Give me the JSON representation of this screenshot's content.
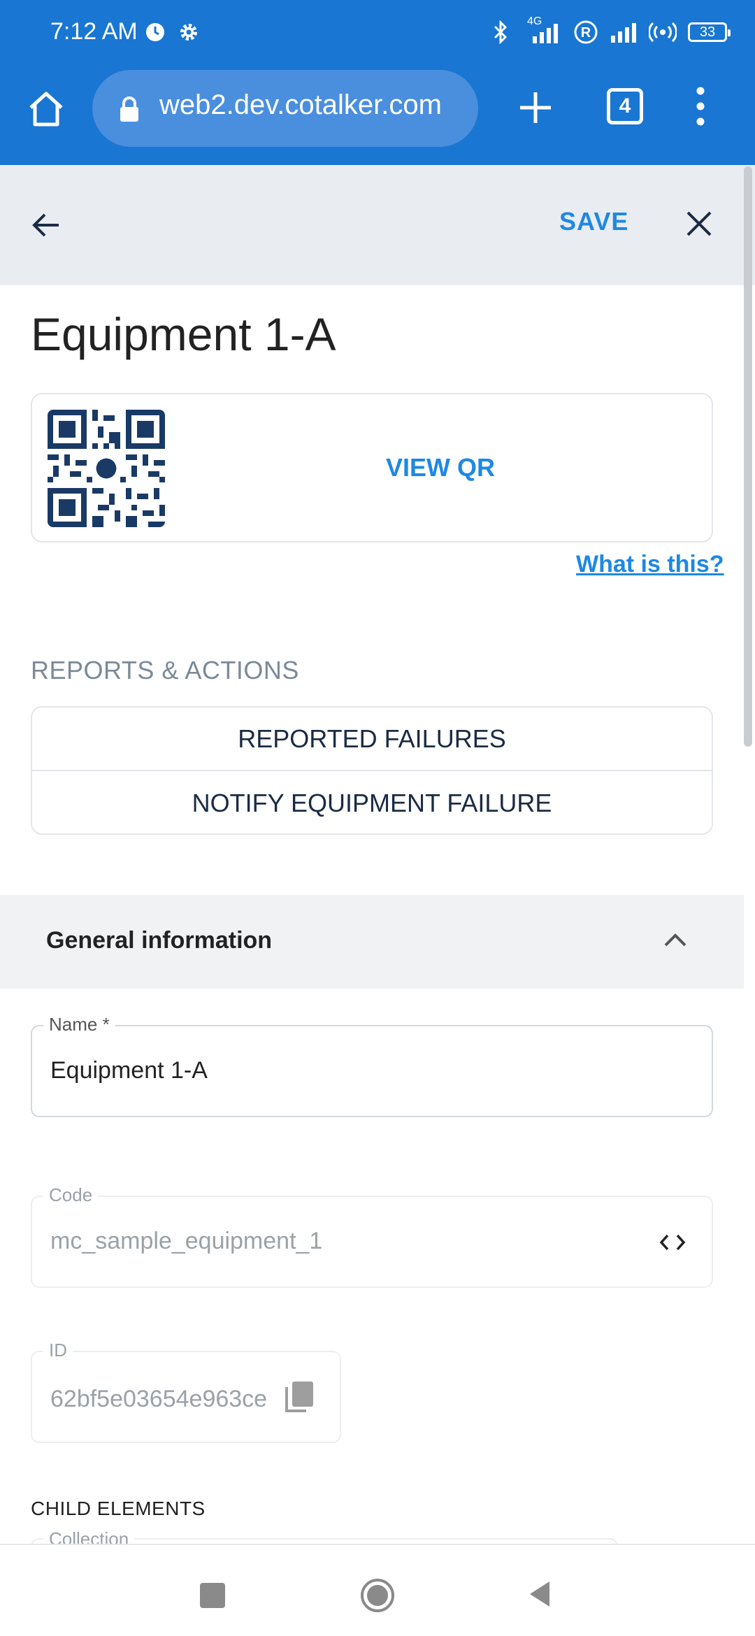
{
  "status_bar": {
    "time": "7:12 AM",
    "network": "4G",
    "battery": "33",
    "icons": [
      "alarm-icon",
      "gear-icon",
      "bluetooth-icon",
      "signal-icon",
      "roaming-icon",
      "signal-icon",
      "hotspot-icon",
      "battery-icon"
    ]
  },
  "browser": {
    "url": "web2.dev.cotalker.com",
    "tab_count": "4",
    "icons": [
      "home-icon",
      "lock-icon",
      "plus-icon",
      "tabs-icon",
      "more-vert-icon"
    ]
  },
  "header": {
    "save_label": "SAVE",
    "icons": [
      "arrow-back-icon",
      "close-icon"
    ]
  },
  "page": {
    "title": "Equipment 1-A"
  },
  "qr": {
    "view_label": "VIEW QR",
    "help_link": "What is this?"
  },
  "reports": {
    "section_label": "REPORTS & ACTIONS",
    "actions": [
      {
        "label": "REPORTED FAILURES"
      },
      {
        "label": "NOTIFY EQUIPMENT FAILURE"
      }
    ]
  },
  "general": {
    "title": "General information",
    "name_label": "Name *",
    "name_value": "Equipment 1-A",
    "code_label": "Code",
    "code_value": "mc_sample_equipment_1",
    "id_label": "ID",
    "id_value": "62bf5e03654e963ce"
  },
  "child_elements": {
    "label": "CHILD ELEMENTS",
    "collection_label": "Collection"
  },
  "colors": {
    "brand_blue": "#1976d2",
    "accent_blue": "#1e88e5",
    "header_gray": "#e9edf1"
  }
}
